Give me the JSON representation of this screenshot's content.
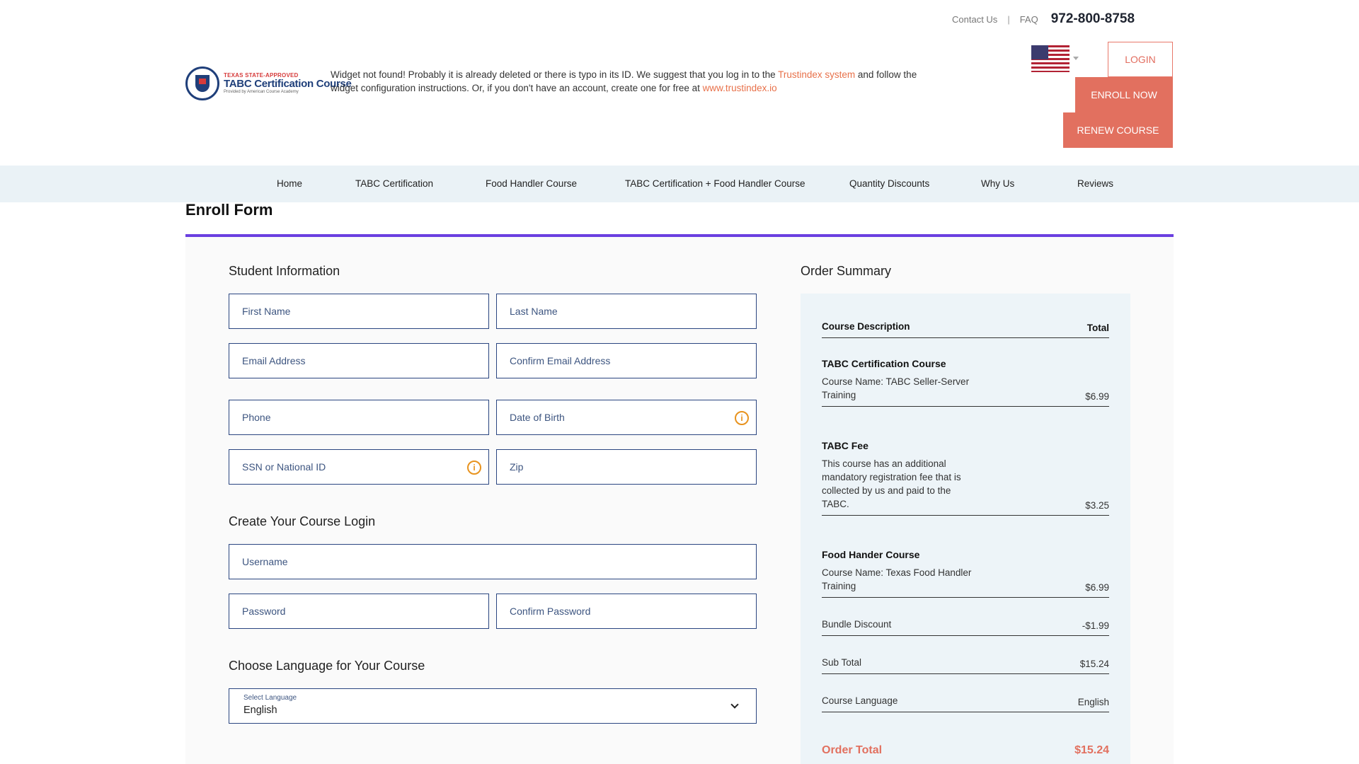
{
  "topbar": {
    "contact": "Contact Us",
    "separator": "|",
    "faq": "FAQ",
    "phone": "972-800-8758"
  },
  "logo": {
    "line1": "TEXAS STATE-APPROVED",
    "line2": "TABC Certification Course",
    "line3": "Provided by American Course Academy"
  },
  "widget_message": {
    "text1": "Widget not found! Probably it is already deleted or there is typo in its ID. We suggest that you log in to the ",
    "link1": "Trustindex system",
    "text2": " and follow the widget configuration instructions. Or, if you don't have an account, create one for free at ",
    "link2": "www.trustindex.io"
  },
  "header_buttons": {
    "login": "LOGIN",
    "enroll": "ENROLL NOW",
    "renew": "RENEW COURSE",
    "flag_icon": "us-flag-icon"
  },
  "nav": {
    "items": [
      "Home",
      "TABC Certification",
      "Food Handler Course",
      "TABC Certification + Food Handler Course",
      "Quantity Discounts",
      "Why Us",
      "Reviews"
    ]
  },
  "page": {
    "title": "Enroll Form"
  },
  "student_info": {
    "heading": "Student Information",
    "first_name": "First Name",
    "last_name": "Last Name",
    "email": "Email Address",
    "confirm_email": "Confirm Email Address",
    "phone": "Phone",
    "dob": "Date of Birth",
    "ssn": "SSN or National ID",
    "zip": "Zip",
    "info_glyph": "i"
  },
  "login_section": {
    "heading": "Create Your Course Login",
    "username": "Username",
    "password": "Password",
    "confirm_password": "Confirm Password"
  },
  "language_section": {
    "heading": "Choose Language for Your Course",
    "select_label": "Select Language",
    "selected": "English"
  },
  "summary": {
    "heading": "Order Summary",
    "col_description": "Course Description",
    "col_total": "Total",
    "tabc_heading": "TABC Certification Course",
    "tabc_desc": "Course Name: TABC Seller-Server Training",
    "tabc_price": "$6.99",
    "fee_heading": "TABC Fee",
    "fee_desc": "This course has an additional mandatory registration fee that is collected by us and paid to the TABC.",
    "fee_price": "$3.25",
    "food_heading": "Food Hander Course",
    "food_desc": "Course Name: Texas Food Handler Training",
    "food_price": "$6.99",
    "bundle_label": "Bundle Discount",
    "bundle_value": "-$1.99",
    "subtotal_label": "Sub Total",
    "subtotal_value": "$15.24",
    "language_label": "Course Language",
    "language_value": "English",
    "order_total_label": "Order Total",
    "order_total_value": "$15.24"
  },
  "colors": {
    "accent": "#e2705f",
    "purple_rule": "#6a3fe0",
    "navy": "#2a4580",
    "nav_bg": "#eaf2f6",
    "summary_bg": "#edf4f8",
    "info_orange": "#e8931e"
  }
}
